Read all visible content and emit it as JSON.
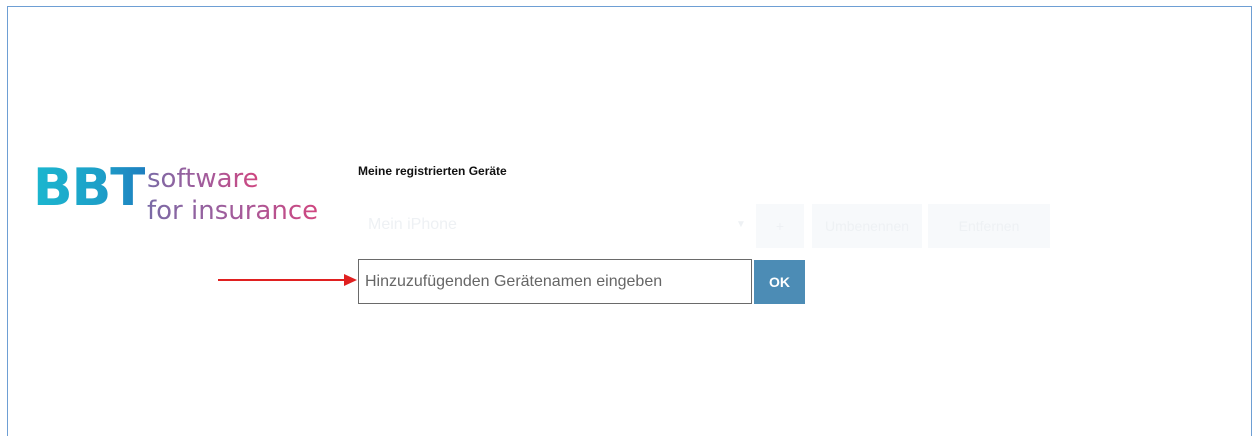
{
  "logo": {
    "bbt": "BBT",
    "line1": "software",
    "line2": "for insurance"
  },
  "devices": {
    "title": "Meine registrierten Geräte",
    "selected_device": "Mein iPhone",
    "add_icon": "plus-icon",
    "rename_label": "Umbenennen",
    "delete_label": "Entfernen",
    "input_placeholder": "Hinzuzufügenden Gerätenamen eingeben",
    "input_value": "",
    "ok_label": "OK"
  },
  "colors": {
    "bbt_blue": "#1d9fc8",
    "tagline_purple": "#a55a9a",
    "ok_button": "#4c8cb5",
    "annotation_arrow": "#e02020"
  }
}
